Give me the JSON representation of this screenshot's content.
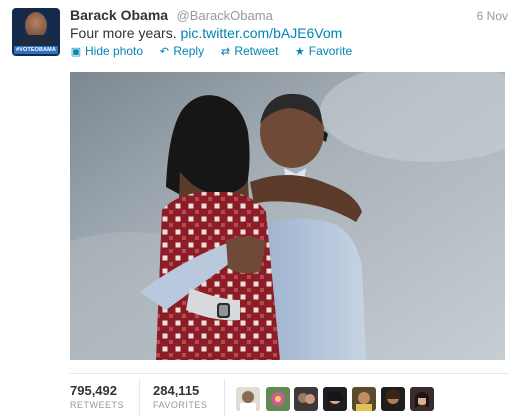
{
  "tweet": {
    "author": {
      "name": "Barack Obama",
      "handle": "@BarackObama",
      "avatar_badge": "#VOTEOBAMA"
    },
    "timestamp": "6 Nov",
    "text": "Four more years.",
    "link": "pic.twitter.com/bAJE6Vom",
    "actions": [
      {
        "label": "Hide photo",
        "icon": "photo-icon"
      },
      {
        "label": "Reply",
        "icon": "reply-arrow-icon"
      },
      {
        "label": "Retweet",
        "icon": "retweet-icon"
      },
      {
        "label": "Favorite",
        "icon": "star-icon"
      }
    ],
    "stats": {
      "retweets": {
        "value": "795,492",
        "label": "RETWEETS"
      },
      "favorites": {
        "value": "284,115",
        "label": "FAVORITES"
      }
    }
  },
  "colors": {
    "link": "#0084b4",
    "name": "#333333",
    "muted": "#999999",
    "divider": "#e8e8e8"
  }
}
